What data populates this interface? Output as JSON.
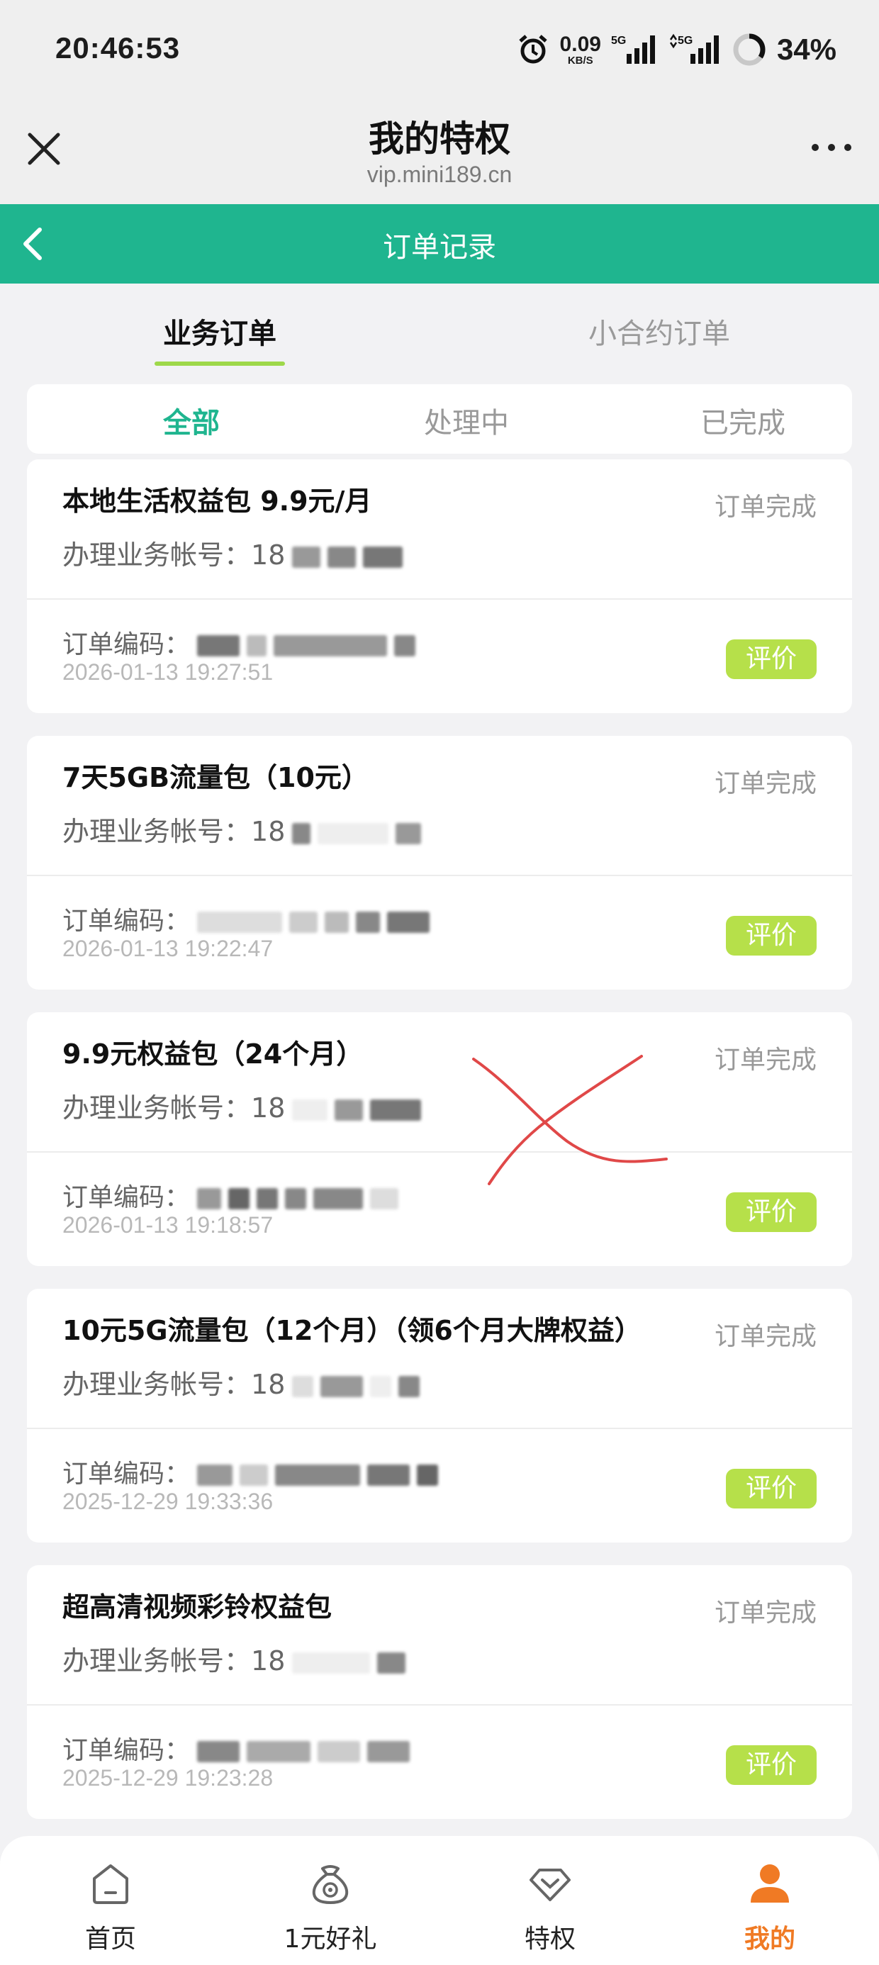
{
  "status_bar": {
    "time": "20:46:53",
    "net_speed_value": "0.09",
    "net_speed_unit": "KB/S",
    "signal1": "5G",
    "signal2": "5G",
    "battery": "34%"
  },
  "header": {
    "title": "我的特权",
    "url": "vip.mini189.cn",
    "close_icon": "close-icon",
    "more_icon": "more-icon"
  },
  "nav_bar": {
    "title": "订单记录",
    "back_icon": "back-icon"
  },
  "tabs": [
    {
      "label": "业务订单",
      "active": true
    },
    {
      "label": "小合约订单",
      "active": false
    }
  ],
  "filters": [
    {
      "label": "全部",
      "active": true
    },
    {
      "label": "处理中",
      "active": false
    },
    {
      "label": "已完成",
      "active": false
    }
  ],
  "orders": [
    {
      "title": "本地生活权益包 9.9元/月",
      "status": "订单完成",
      "account_label": "办理业务帐号：",
      "account_value": "18",
      "code_label": "订单编码：",
      "date": "2026-01-13 19:27:51",
      "rate_label": "评价"
    },
    {
      "title": "7天5GB流量包（10元）",
      "status": "订单完成",
      "account_label": "办理业务帐号：",
      "account_value": "18",
      "code_label": "订单编码：",
      "date": "2026-01-13 19:22:47",
      "rate_label": "评价"
    },
    {
      "title": "9.9元权益包（24个月）",
      "status": "订单完成",
      "account_label": "办理业务帐号：",
      "account_value": "18",
      "code_label": "订单编码：",
      "date": "2026-01-13 19:18:57",
      "rate_label": "评价"
    },
    {
      "title": "10元5G流量包（12个月）（领6个月大牌权益）",
      "status": "订单完成",
      "account_label": "办理业务帐号：",
      "account_value": "18",
      "code_label": "订单编码：",
      "date": "2025-12-29 19:33:36",
      "rate_label": "评价"
    },
    {
      "title": "超高清视频彩铃权益包",
      "status": "订单完成",
      "account_label": "办理业务帐号：",
      "account_value": "18",
      "code_label": "订单编码：",
      "date": "2025-12-29 19:23:28",
      "rate_label": "评价"
    }
  ],
  "bottom_nav": [
    {
      "label": "首页",
      "icon": "home-icon",
      "active": false
    },
    {
      "label": "1元好礼",
      "icon": "gift-bag-icon",
      "active": false
    },
    {
      "label": "特权",
      "icon": "diamond-icon",
      "active": false
    },
    {
      "label": "我的",
      "icon": "user-icon",
      "active": true
    }
  ],
  "colors": {
    "brand_green": "#1fb58f",
    "lime_button": "#b6e04a",
    "active_orange": "#f07a24",
    "annotation_red": "#e04848"
  }
}
